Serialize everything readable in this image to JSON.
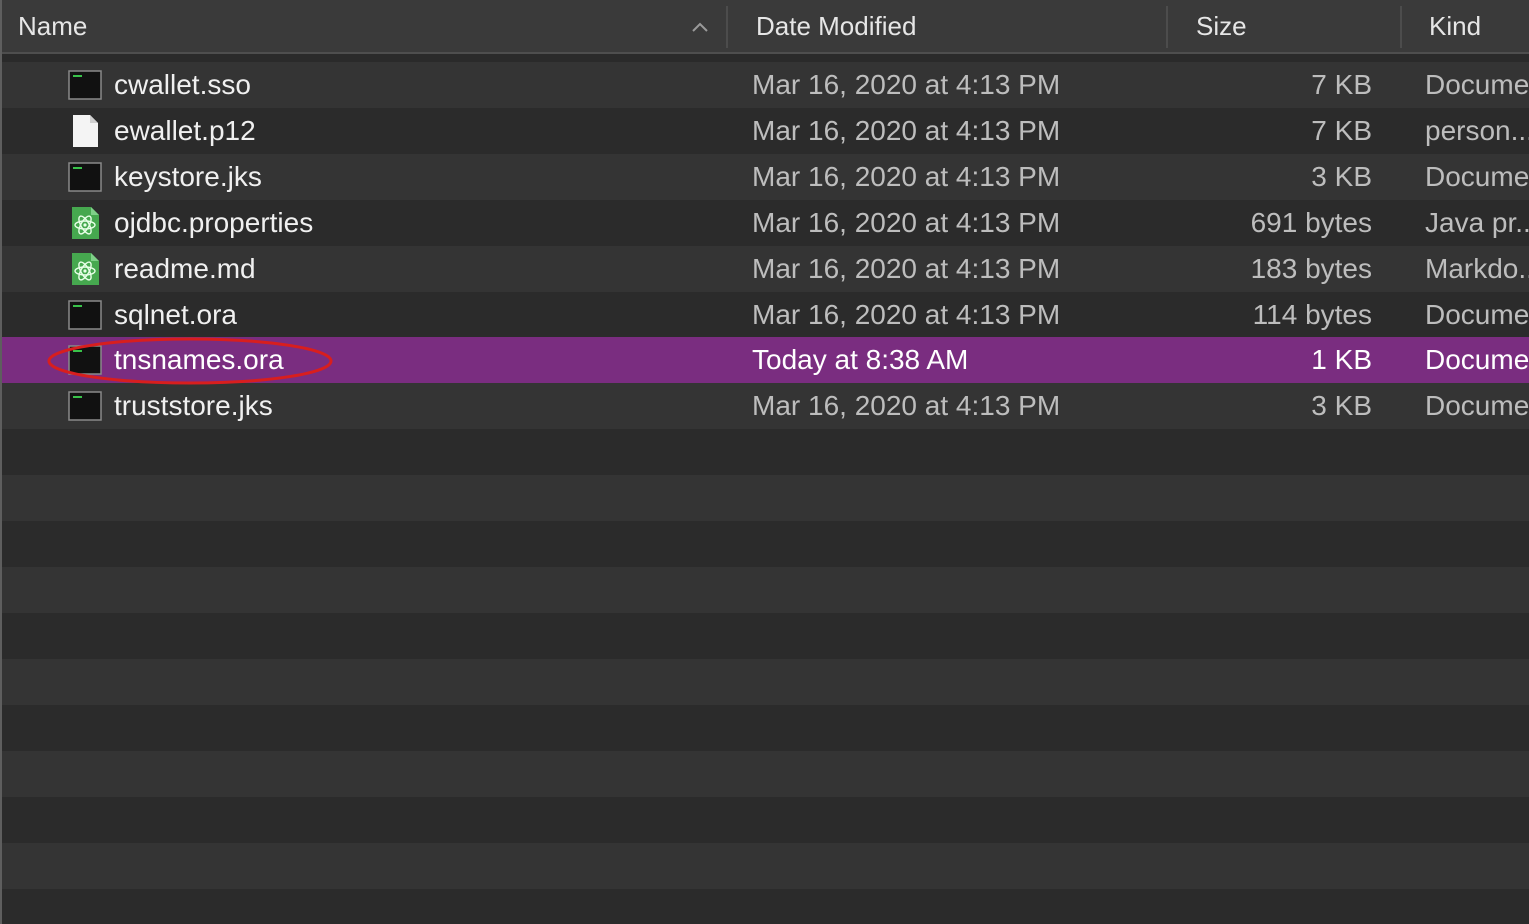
{
  "columns": {
    "name": "Name",
    "date": "Date Modified",
    "size": "Size",
    "kind": "Kind"
  },
  "sort": {
    "column": "name",
    "direction": "ascending",
    "icon": "chevron-up-icon"
  },
  "files": [
    {
      "name": "cwallet.sso",
      "date": "Mar 16, 2020 at 4:13 PM",
      "size": "7 KB",
      "kind": "Docume",
      "icon": "terminal-document-icon"
    },
    {
      "name": "ewallet.p12",
      "date": "Mar 16, 2020 at 4:13 PM",
      "size": "7 KB",
      "kind": "person...",
      "icon": "blank-document-icon"
    },
    {
      "name": "keystore.jks",
      "date": "Mar 16, 2020 at 4:13 PM",
      "size": "3 KB",
      "kind": "Docume",
      "icon": "terminal-document-icon"
    },
    {
      "name": "ojdbc.properties",
      "date": "Mar 16, 2020 at 4:13 PM",
      "size": "691 bytes",
      "kind": "Java pr...",
      "icon": "atom-document-icon"
    },
    {
      "name": "readme.md",
      "date": "Mar 16, 2020 at 4:13 PM",
      "size": "183 bytes",
      "kind": "Markdo...",
      "icon": "atom-document-icon"
    },
    {
      "name": "sqlnet.ora",
      "date": "Mar 16, 2020 at 4:13 PM",
      "size": "114 bytes",
      "kind": "Docume",
      "icon": "terminal-document-icon"
    },
    {
      "name": "tnsnames.ora",
      "date": "Today at 8:38 AM",
      "size": "1 KB",
      "kind": "Docume",
      "icon": "terminal-document-icon",
      "selected": true
    },
    {
      "name": "truststore.jks",
      "date": "Mar 16, 2020 at 4:13 PM",
      "size": "3 KB",
      "kind": "Docume",
      "icon": "terminal-document-icon"
    }
  ],
  "colors": {
    "selection": "#7a2d80",
    "annotation": "#d81e1e"
  }
}
